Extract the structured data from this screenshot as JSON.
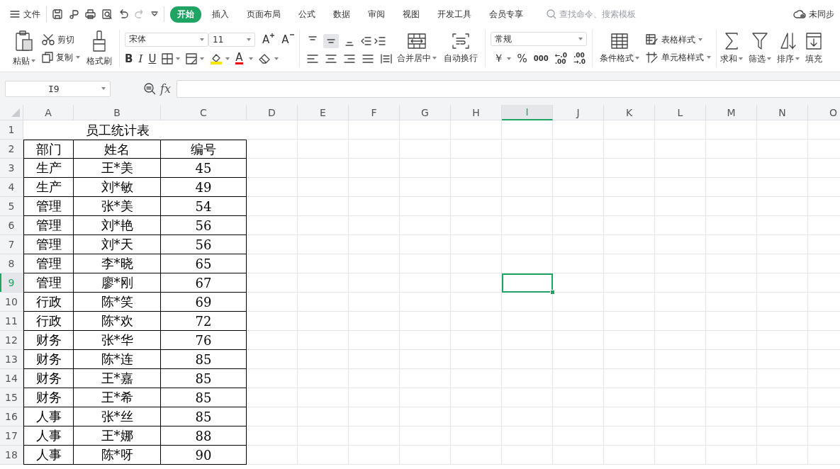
{
  "menu": {
    "file": "文件",
    "tabs": [
      {
        "label": "开始",
        "selected": true
      },
      {
        "label": "插入",
        "selected": false
      },
      {
        "label": "页面布局",
        "selected": false
      },
      {
        "label": "公式",
        "selected": false
      },
      {
        "label": "数据",
        "selected": false
      },
      {
        "label": "审阅",
        "selected": false
      },
      {
        "label": "视图",
        "selected": false
      },
      {
        "label": "开发工具",
        "selected": false
      },
      {
        "label": "会员专享",
        "selected": false
      }
    ],
    "search": {
      "placeholder": "查找命令、搜索模板"
    },
    "sync": "未同步"
  },
  "ribbon": {
    "clipboard": {
      "paste": "粘贴",
      "cut": "剪切",
      "copy": "复制",
      "format_painter": "格式刷"
    },
    "font": {
      "name": "宋体",
      "size": "11",
      "grow": "A",
      "shrink": "A",
      "bold": "B",
      "italic": "I",
      "underline": "U",
      "font_color_label": "A"
    },
    "alignment": {
      "vertical": [
        {
          "selected": false
        },
        {
          "selected": true
        },
        {
          "selected": false
        }
      ],
      "merge": "合并居中",
      "wrap": "自动换行"
    },
    "number": {
      "format": "常规",
      "currency": "￥",
      "percent": "%",
      "thousands": "000",
      "increase_decimal": [
        "←.0",
        ".00"
      ],
      "decrease_decimal": [
        ".00",
        "→.0"
      ]
    },
    "styles": {
      "conditional": "条件格式",
      "table_style": "表格样式",
      "cell_style": "单元格样式"
    },
    "editing": {
      "sum": "求和",
      "filter": "筛选",
      "sort": "排序",
      "fill": "填充"
    }
  },
  "formula_bar": {
    "name_box": "I9",
    "fx": "fx"
  },
  "sheet": {
    "columns": [
      {
        "label": "A",
        "selected": false
      },
      {
        "label": "B",
        "selected": false
      },
      {
        "label": "C",
        "selected": false
      },
      {
        "label": "D",
        "selected": false
      },
      {
        "label": "E",
        "selected": false
      },
      {
        "label": "F",
        "selected": false
      },
      {
        "label": "G",
        "selected": false
      },
      {
        "label": "H",
        "selected": false
      },
      {
        "label": "I",
        "selected": true
      },
      {
        "label": "J",
        "selected": false
      },
      {
        "label": "K",
        "selected": false
      },
      {
        "label": "L",
        "selected": false
      },
      {
        "label": "M",
        "selected": false
      },
      {
        "label": "N",
        "selected": false
      },
      {
        "label": "O",
        "selected": false
      }
    ],
    "rows": [
      {
        "label": "1",
        "selected": false,
        "kind": "title",
        "cells": [
          "",
          "员工统计表",
          ""
        ]
      },
      {
        "label": "2",
        "selected": false,
        "kind": "data",
        "cells": [
          "部门",
          "姓名",
          "编号"
        ]
      },
      {
        "label": "3",
        "selected": false,
        "kind": "data",
        "cells": [
          "生产",
          "王*美",
          "45"
        ]
      },
      {
        "label": "4",
        "selected": false,
        "kind": "data",
        "cells": [
          "生产",
          "刘*敏",
          "49"
        ]
      },
      {
        "label": "5",
        "selected": false,
        "kind": "data",
        "cells": [
          "管理",
          "张*美",
          "54"
        ]
      },
      {
        "label": "6",
        "selected": false,
        "kind": "data",
        "cells": [
          "管理",
          "刘*艳",
          "56"
        ]
      },
      {
        "label": "7",
        "selected": false,
        "kind": "data",
        "cells": [
          "管理",
          "刘*天",
          "56"
        ]
      },
      {
        "label": "8",
        "selected": false,
        "kind": "data",
        "cells": [
          "管理",
          "李*晓",
          "65"
        ]
      },
      {
        "label": "9",
        "selected": true,
        "kind": "data",
        "cells": [
          "管理",
          "廖*刚",
          "67"
        ]
      },
      {
        "label": "10",
        "selected": false,
        "kind": "data",
        "cells": [
          "行政",
          "陈*笑",
          "69"
        ]
      },
      {
        "label": "11",
        "selected": false,
        "kind": "data",
        "cells": [
          "行政",
          "陈*欢",
          "72"
        ]
      },
      {
        "label": "12",
        "selected": false,
        "kind": "data",
        "cells": [
          "财务",
          "张*华",
          "76"
        ]
      },
      {
        "label": "13",
        "selected": false,
        "kind": "data",
        "cells": [
          "财务",
          "陈*连",
          "85"
        ]
      },
      {
        "label": "14",
        "selected": false,
        "kind": "data",
        "cells": [
          "财务",
          "王*嘉",
          "85"
        ]
      },
      {
        "label": "15",
        "selected": false,
        "kind": "data",
        "cells": [
          "财务",
          "王*希",
          "85"
        ]
      },
      {
        "label": "16",
        "selected": false,
        "kind": "data",
        "cells": [
          "人事",
          "张*丝",
          "85"
        ]
      },
      {
        "label": "17",
        "selected": false,
        "kind": "data",
        "cells": [
          "人事",
          "王*娜",
          "88"
        ]
      },
      {
        "label": "18",
        "selected": false,
        "kind": "data",
        "cells": [
          "人事",
          "陈*呀",
          "90"
        ]
      }
    ]
  }
}
